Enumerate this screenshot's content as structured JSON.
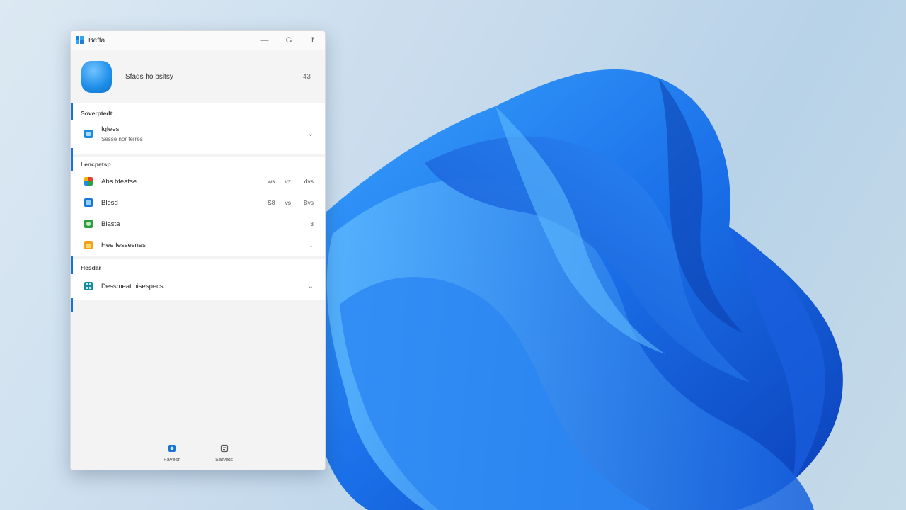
{
  "window": {
    "title": "Beffa",
    "min_glyph": "—",
    "max_glyph": "G",
    "close_glyph": "ř"
  },
  "profile": {
    "name": "Sfads ho bsitsy",
    "count": "43"
  },
  "sections": {
    "s1": {
      "header": "Soverptedt",
      "item": {
        "label": "Iqlees",
        "sub": "Sesse nor ferres",
        "chev": "⌄"
      }
    },
    "s2": {
      "header": "Lencpetsp",
      "items": [
        {
          "label": "Abs bteatse",
          "cols": [
            "ws",
            "vz",
            "dvs"
          ],
          "icon": "colorful-grid-icon"
        },
        {
          "label": "Blesd",
          "cols": [
            "S8",
            "vs",
            "Bvs"
          ],
          "icon": "blue-store-icon"
        },
        {
          "label": "Blasta",
          "cols": [
            "",
            "",
            "3"
          ],
          "icon": "green-gear-icon"
        },
        {
          "label": "Hee fessesnes",
          "cols": [
            "",
            "",
            "⌄"
          ],
          "icon": "orange-folder-icon"
        }
      ]
    },
    "s3": {
      "header": "Hesdar",
      "item": {
        "label": "Dessmeat hisespecs",
        "chev": "⌄"
      }
    }
  },
  "nav": [
    {
      "label": "Favesr"
    },
    {
      "label": "Satvets"
    }
  ],
  "colors": {
    "accent": "#1a73d2",
    "wallpaper_bloom": "#1e6fe6"
  }
}
